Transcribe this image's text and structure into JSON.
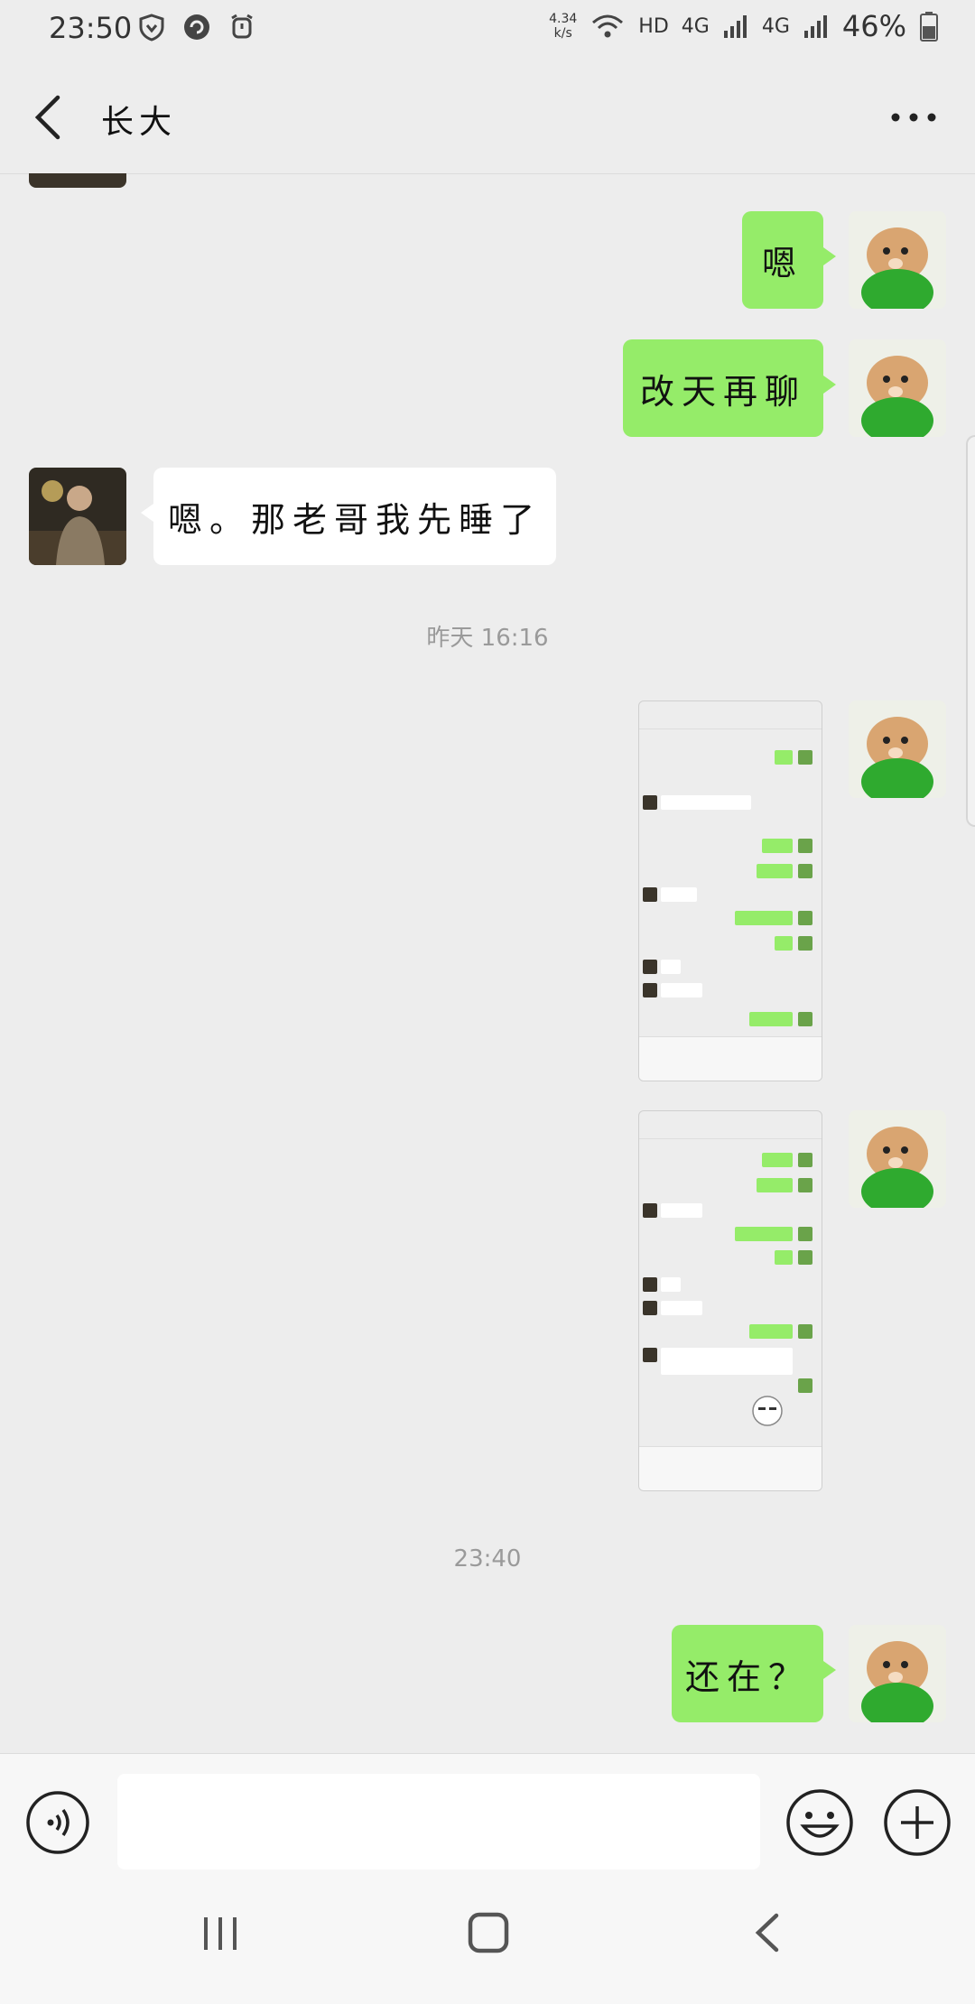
{
  "status_bar": {
    "time": "23:50",
    "net_speed": "4.34",
    "net_unit": "k/s",
    "hd": "HD",
    "network": "4G",
    "network2": "4G",
    "battery": "46%"
  },
  "header": {
    "title": "长大",
    "back_icon": "chevron-left-icon",
    "more_icon": "more-dots-icon"
  },
  "messages": [
    {
      "side": "me",
      "text": "嗯"
    },
    {
      "side": "me",
      "text": "改天再聊"
    },
    {
      "side": "other",
      "text": "嗯。那老哥我先睡了"
    },
    {
      "timestamp": "昨天 16:16"
    },
    {
      "side": "me",
      "type": "image"
    },
    {
      "side": "me",
      "type": "image"
    },
    {
      "timestamp": "23:40"
    },
    {
      "side": "me",
      "text": "还在？"
    }
  ],
  "input_bar": {
    "placeholder": "",
    "voice_icon": "voice-icon",
    "emoji_icon": "emoji-icon",
    "plus_icon": "plus-icon"
  },
  "nav_bar": {
    "recent_icon": "recent-apps-icon",
    "home_icon": "home-icon",
    "back_icon": "back-icon"
  },
  "colors": {
    "background": "#ededed",
    "my_bubble": "#95ec69",
    "their_bubble": "#ffffff",
    "timestamp_text": "#9a9a9a"
  }
}
